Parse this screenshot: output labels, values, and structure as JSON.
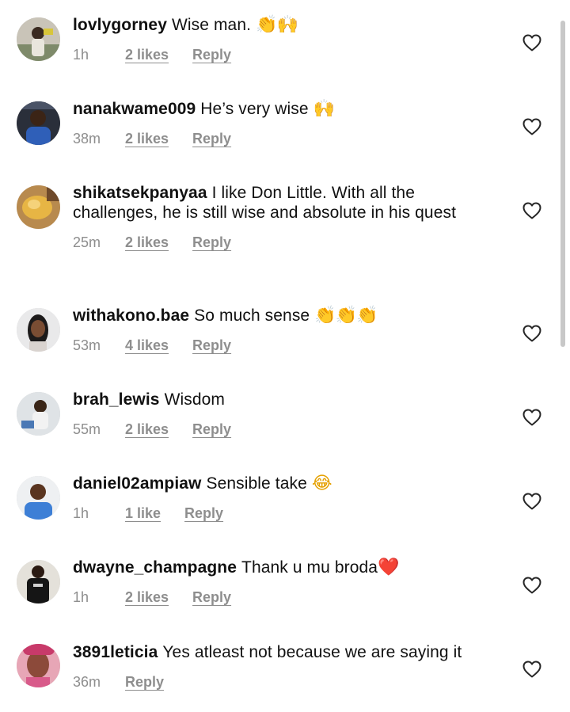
{
  "comments": [
    {
      "username": "lovlygorney",
      "text": "Wise man.",
      "emoji": "👏🙌",
      "time": "1h",
      "likes": "2 likes",
      "reply": "Reply"
    },
    {
      "username": "nanakwame009",
      "text": "He’s very wise",
      "emoji": "🙌",
      "time": "38m",
      "likes": "2 likes",
      "reply": "Reply"
    },
    {
      "username": "shikatsekpanyaa",
      "text": "I like Don Little. With all the challenges,  he is still wise and absolute in his quest",
      "emoji": "",
      "time": "25m",
      "likes": "2 likes",
      "reply": "Reply"
    },
    {
      "username": "withakono.bae",
      "text": "So much sense",
      "emoji": "👏👏👏",
      "time": "53m",
      "likes": "4 likes",
      "reply": "Reply"
    },
    {
      "username": "brah_lewis",
      "text": "Wisdom",
      "emoji": "",
      "time": "55m",
      "likes": "2 likes",
      "reply": "Reply"
    },
    {
      "username": "daniel02ampiaw",
      "text": "Sensible  take",
      "emoji": "😂",
      "time": "1h",
      "likes": "1 like",
      "reply": "Reply"
    },
    {
      "username": "dwayne_champagne",
      "text": "Thank u mu broda",
      "emoji": "❤️",
      "time": "1h",
      "likes": "2 likes",
      "reply": "Reply"
    },
    {
      "username": "3891leticia",
      "text": "Yes atleast not because we are saying it",
      "emoji": "",
      "time": "36m",
      "likes": "",
      "reply": "Reply"
    }
  ],
  "icons": {
    "like": "heart-outline-icon"
  },
  "colors": {
    "text": "#111111",
    "meta": "#8e8e8e",
    "heart": "#262626",
    "scrollbar": "#c8c8c8"
  }
}
